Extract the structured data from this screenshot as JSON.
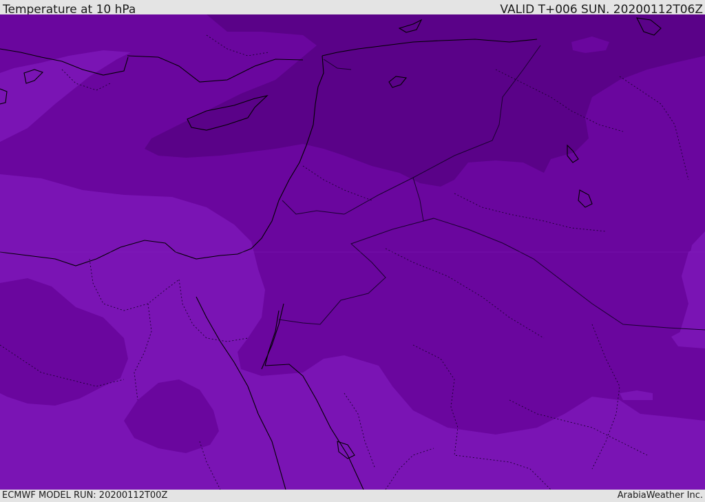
{
  "header": {
    "title": "Temperature at 10 hPa",
    "valid": "VALID T+006 SUN. 20200112T06Z"
  },
  "footer": {
    "model_run": "ECMWF MODEL RUN: 20200112T00Z",
    "credit": "ArabiaWeather Inc."
  },
  "map": {
    "fill_colors": {
      "band_warmest": "#7a14b4",
      "band_mid": "#6a069e",
      "band_cold": "#5a0288"
    },
    "line_colors": {
      "coastline": "#000000",
      "borders": "#1a0030"
    }
  }
}
